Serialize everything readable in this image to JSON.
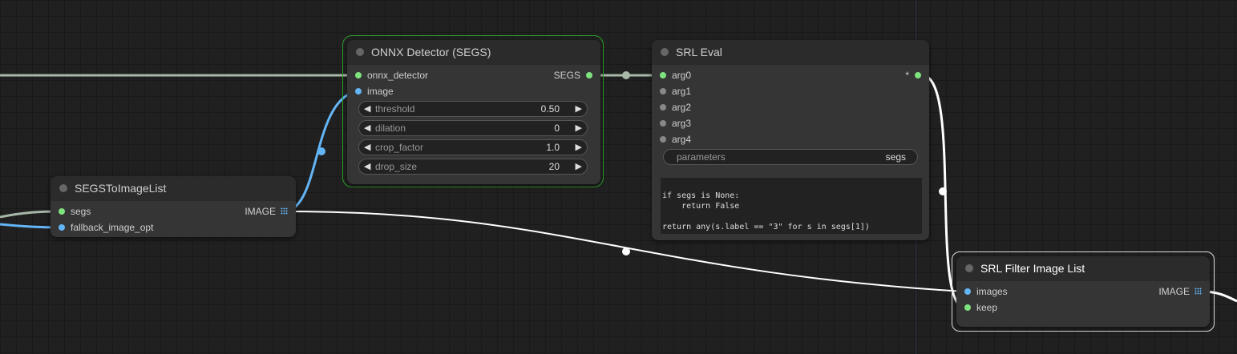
{
  "nodes": {
    "onnx": {
      "title": "ONNX Detector (SEGS)",
      "inputs": [
        "onnx_detector",
        "image"
      ],
      "output": "SEGS",
      "widgets": [
        {
          "name": "threshold",
          "value": "0.50"
        },
        {
          "name": "dilation",
          "value": "0"
        },
        {
          "name": "crop_factor",
          "value": "1.0"
        },
        {
          "name": "drop_size",
          "value": "20"
        }
      ]
    },
    "srl_eval": {
      "title": "SRL Eval",
      "inputs": [
        "arg0",
        "arg1",
        "arg2",
        "arg3",
        "arg4"
      ],
      "output": "*",
      "parameters_label": "parameters",
      "parameters_value": "segs",
      "code_lines": [
        "if segs is None:",
        "    return False",
        "",
        "return any(s.label == \"3\" for s in segs[1])"
      ]
    },
    "segs_to_image": {
      "title": "SEGSToImageList",
      "inputs": [
        "segs",
        "fallback_image_opt"
      ],
      "output": "IMAGE"
    },
    "srl_filter": {
      "title": "SRL Filter Image List",
      "inputs": [
        "images",
        "keep"
      ],
      "output": "IMAGE"
    }
  },
  "colors": {
    "canvas_bg": "#202020",
    "node_bg": "#353535",
    "selected_border": "#2aa02a",
    "image_wire": "#64b5f6",
    "detector_wire": "#a8b8a8",
    "bool_wire": "#ffffff",
    "pin_green": "#7ee27e",
    "pin_blue": "#64b5f6"
  }
}
